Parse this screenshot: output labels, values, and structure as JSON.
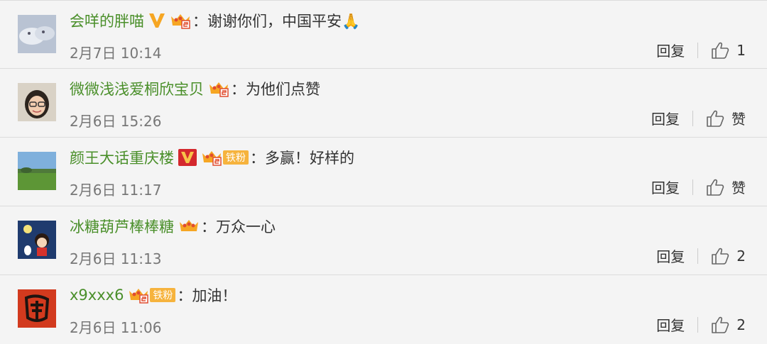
{
  "comments": [
    {
      "username": "会咩的胖喵",
      "content": "谢谢你们，中国平安🙏",
      "time": "2月7日 10:14",
      "reply": "回复",
      "likes": "1",
      "verified": "gold"
    },
    {
      "username": "微微浅浅爱桐欣宝贝",
      "content": "为他们点赞",
      "time": "2月6日 15:26",
      "reply": "回复",
      "likes": "赞"
    },
    {
      "username": "颜王大话重庆楼",
      "content": "多赢！好样的",
      "time": "2月6日 11:17",
      "reply": "回复",
      "likes": "赞",
      "verified": "red",
      "fan_label": "铁粉"
    },
    {
      "username": "冰糖葫芦棒棒糖",
      "content": "万众一心",
      "time": "2月6日 11:13",
      "reply": "回复",
      "likes": "2"
    },
    {
      "username": "x9xxx6",
      "content": "加油！",
      "time": "2月6日 11:06",
      "reply": "回复",
      "likes": "2",
      "fan_label": "铁粉"
    }
  ],
  "separator": "：",
  "icons": {
    "verified_gold": "verified-v-icon",
    "verified_red": "verified-v-icon",
    "member": "crown-member-icon",
    "like": "thumbs-up-icon"
  },
  "colors": {
    "username": "#4a8f2a",
    "fan_badge": "#f6b33d",
    "verified_gold": "#f6a623",
    "verified_red": "#d4282d"
  }
}
